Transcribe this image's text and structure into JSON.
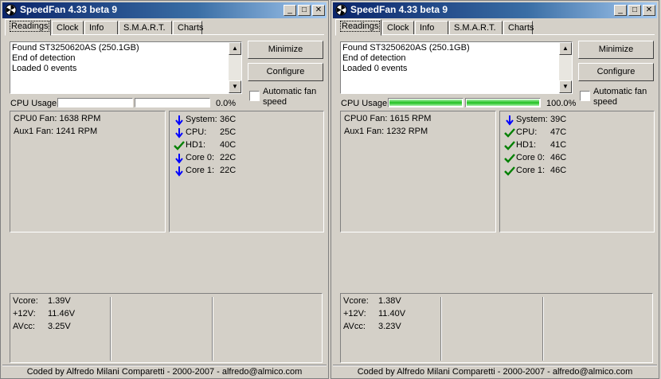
{
  "windows": [
    {
      "title": "SpeedFan 4.33 beta 9",
      "tabs": [
        "Readings",
        "Clock",
        "Info",
        "S.M.A.R.T.",
        "Charts"
      ],
      "log": [
        "Found ST3250620AS (250.1GB)",
        "End of detection",
        "Loaded 0 events"
      ],
      "buttons": {
        "minimize": "Minimize",
        "configure": "Configure"
      },
      "auto_fan_label": "Automatic fan speed",
      "cpu_usage_label": "CPU Usage",
      "cpu_usage_pct": "0.0%",
      "cpu_bars": [
        0,
        0
      ],
      "fans": [
        "CPU0 Fan: 1638 RPM",
        "Aux1 Fan:  1241 RPM"
      ],
      "temps": [
        {
          "name": "System:",
          "value": "36C",
          "icon": "arrow-down-icon"
        },
        {
          "name": "CPU:",
          "value": "25C",
          "icon": "arrow-down-icon"
        },
        {
          "name": "HD1:",
          "value": "40C",
          "icon": "check-icon"
        },
        {
          "name": "Core 0:",
          "value": "22C",
          "icon": "arrow-down-icon"
        },
        {
          "name": "Core 1:",
          "value": "22C",
          "icon": "arrow-down-icon"
        }
      ],
      "volts": [
        {
          "name": "Vcore:",
          "value": "1.39V"
        },
        {
          "name": "+12V:",
          "value": "11.46V"
        },
        {
          "name": "AVcc:",
          "value": "3.25V"
        }
      ],
      "footer": "Coded by Alfredo Milani Comparetti - 2000-2007 - alfredo@almico.com"
    },
    {
      "title": "SpeedFan 4.33 beta 9",
      "tabs": [
        "Readings",
        "Clock",
        "Info",
        "S.M.A.R.T.",
        "Charts"
      ],
      "log": [
        "Found ST3250620AS (250.1GB)",
        "End of detection",
        "Loaded 0 events"
      ],
      "buttons": {
        "minimize": "Minimize",
        "configure": "Configure"
      },
      "auto_fan_label": "Automatic fan speed",
      "cpu_usage_label": "CPU Usage",
      "cpu_usage_pct": "100.0%",
      "cpu_bars": [
        1,
        1
      ],
      "fans": [
        "CPU0 Fan: 1615 RPM",
        "Aux1 Fan:  1232 RPM"
      ],
      "temps": [
        {
          "name": "System:",
          "value": "39C",
          "icon": "arrow-down-icon"
        },
        {
          "name": "CPU:",
          "value": "47C",
          "icon": "check-icon"
        },
        {
          "name": "HD1:",
          "value": "41C",
          "icon": "check-icon"
        },
        {
          "name": "Core 0:",
          "value": "46C",
          "icon": "check-icon"
        },
        {
          "name": "Core 1:",
          "value": "46C",
          "icon": "check-icon"
        }
      ],
      "volts": [
        {
          "name": "Vcore:",
          "value": "1.38V"
        },
        {
          "name": "+12V:",
          "value": "11.40V"
        },
        {
          "name": "AVcc:",
          "value": "3.23V"
        }
      ],
      "footer": "Coded by Alfredo Milani Comparetti - 2000-2007 - alfredo@almico.com"
    }
  ],
  "colors": {
    "title_start": "#0a246a",
    "title_end": "#a6caf0",
    "arrow": "#0000ff",
    "check": "#008000",
    "bar_fill": "#20c020"
  }
}
